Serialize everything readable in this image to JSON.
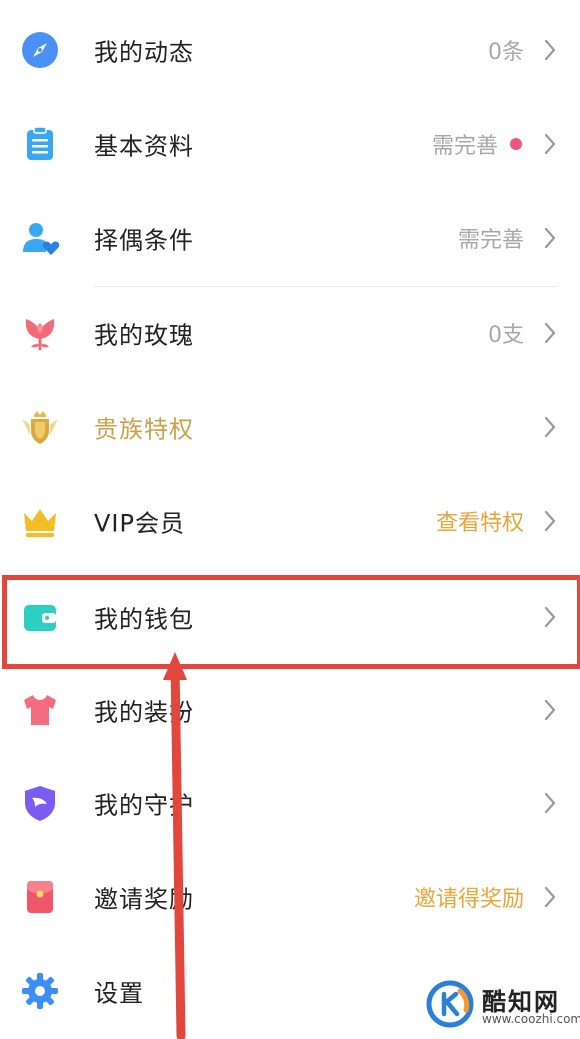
{
  "menu": {
    "items": [
      {
        "label": "我的动态",
        "value": "0条",
        "icon": "compass-icon"
      },
      {
        "label": "基本资料",
        "value": "需完善",
        "icon": "clipboard-icon",
        "badge_color": "#f0557a"
      },
      {
        "label": "择偶条件",
        "value": "需完善",
        "icon": "person-heart-icon"
      },
      {
        "label": "我的玫瑰",
        "value": "0支",
        "icon": "rose-icon"
      },
      {
        "label": "贵族特权",
        "value": "",
        "icon": "noble-shield-icon"
      },
      {
        "label": "VIP会员",
        "value": "查看特权",
        "icon": "crown-icon"
      },
      {
        "label": "我的钱包",
        "value": "",
        "icon": "wallet-icon"
      },
      {
        "label": "我的装扮",
        "value": "",
        "icon": "tshirt-icon"
      },
      {
        "label": "我的守护",
        "value": "",
        "icon": "guardian-shield-icon"
      },
      {
        "label": "邀请奖励",
        "value": "邀请得奖励",
        "icon": "red-envelope-icon"
      },
      {
        "label": "设置",
        "value": "",
        "icon": "gear-icon"
      }
    ]
  },
  "annotation": {
    "highlight_color": "#e2473d",
    "highlighted_item": "我的钱包"
  },
  "watermark": {
    "brand": "酷知网",
    "site": "www.coozhi.com"
  },
  "colors": {
    "label": "#222222",
    "noble_label": "#caa24a",
    "value_grey": "#a8a8a8",
    "value_orange": "#e9a53a"
  }
}
